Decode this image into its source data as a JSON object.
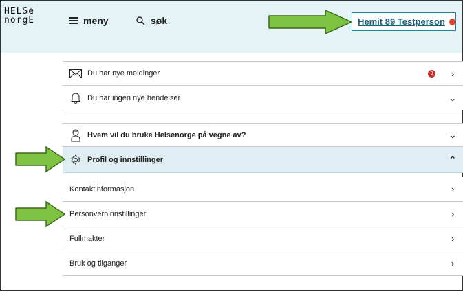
{
  "logo": {
    "line1": "HELSe",
    "line2": "norgE"
  },
  "nav": {
    "menu_label": "meny",
    "search_label": "søk"
  },
  "user": {
    "name": "Hemit 89 Testperson"
  },
  "notifications": {
    "messages_label": "Du har nye meldinger",
    "messages_count": "3",
    "events_label": "Du har ingen nye hendelser"
  },
  "sections": {
    "behalf_label": "Hvem vil du bruke Helsenorge på vegne av?",
    "profile_label": "Profil og innstillinger"
  },
  "profile_menu": [
    {
      "label": "Kontaktinformasjon"
    },
    {
      "label": "Personverninnstillinger"
    },
    {
      "label": "Fullmakter"
    },
    {
      "label": "Bruk og tilganger"
    }
  ],
  "colors": {
    "header_bg": "#e4f3f5",
    "accent": "#1c5f80",
    "badge": "#c72c2c",
    "arrow_fill": "#7ec242",
    "arrow_stroke": "#3f6b1e"
  }
}
